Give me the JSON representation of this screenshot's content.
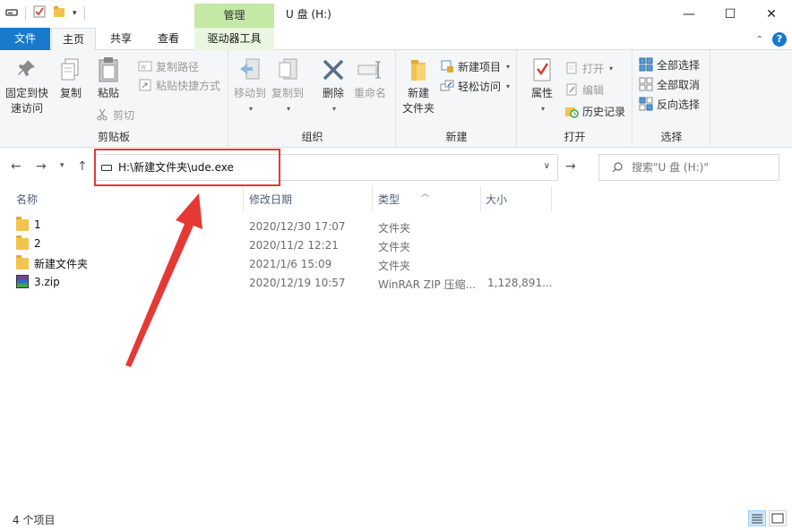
{
  "titlebar": {
    "manage_tab": "管理",
    "window_title": "U 盘 (H:)",
    "minimize": "—",
    "maximize": "☐",
    "close": "✕"
  },
  "tabs": {
    "file": "文件",
    "home": "主页",
    "share": "共享",
    "view": "查看",
    "drive_tools": "驱动器工具"
  },
  "ribbon": {
    "clipboard": {
      "label": "剪贴板",
      "pin": "固定到快\n速访问",
      "pin_line1": "固定到快",
      "pin_line2": "速访问",
      "copy": "复制",
      "paste": "粘贴",
      "copy_path": "复制路径",
      "paste_shortcut": "粘贴快捷方式",
      "cut": "剪切"
    },
    "organize": {
      "label": "组织",
      "move_to": "移动到",
      "copy_to": "复制到",
      "delete": "删除",
      "rename": "重命名"
    },
    "new": {
      "label": "新建",
      "new_folder_line1": "新建",
      "new_folder_line2": "文件夹",
      "new_item": "新建项目",
      "easy_access": "轻松访问"
    },
    "open": {
      "label": "打开",
      "properties": "属性",
      "open": "打开",
      "edit": "编辑",
      "history": "历史记录"
    },
    "select": {
      "label": "选择",
      "select_all": "全部选择",
      "select_none": "全部取消",
      "invert": "反向选择"
    }
  },
  "address": {
    "value": "H:\\新建文件夹\\ude.exe"
  },
  "search": {
    "placeholder": "搜索\"U 盘 (H:)\""
  },
  "columns": {
    "name": "名称",
    "modified": "修改日期",
    "type": "类型",
    "size": "大小"
  },
  "files": [
    {
      "name": "1",
      "modified": "2020/12/30 17:07",
      "type": "文件夹",
      "size": "",
      "icon": "folder-icon"
    },
    {
      "name": "2",
      "modified": "2020/11/2 12:21",
      "type": "文件夹",
      "size": "",
      "icon": "folder-icon"
    },
    {
      "name": "新建文件夹",
      "modified": "2021/1/6 15:09",
      "type": "文件夹",
      "size": "",
      "icon": "folder-icon"
    },
    {
      "name": "3.zip",
      "modified": "2020/12/19 10:57",
      "type": "WinRAR ZIP 压缩...",
      "size": "1,128,891...",
      "icon": "winrar-zip-icon"
    }
  ],
  "status": {
    "count": "4 个项目"
  },
  "colors": {
    "file_tab": "#1979ca",
    "manage_tab": "#c4e8a5",
    "annotation": "#e53935"
  }
}
